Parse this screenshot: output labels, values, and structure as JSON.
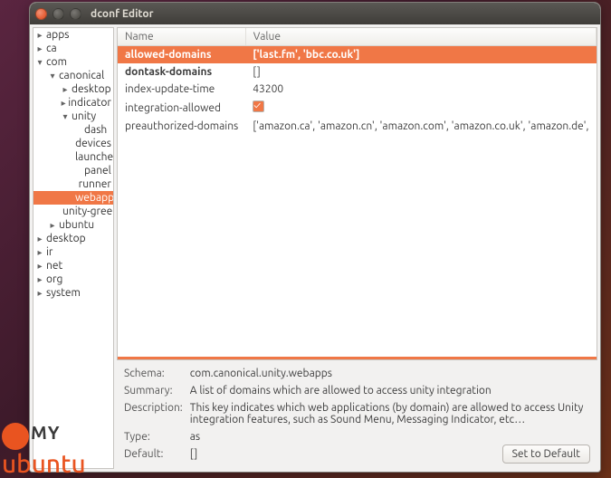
{
  "window": {
    "title": "dconf Editor"
  },
  "tree": [
    {
      "label": "apps",
      "depth": 0,
      "expanded": false,
      "hasChildren": true
    },
    {
      "label": "ca",
      "depth": 0,
      "expanded": false,
      "hasChildren": true
    },
    {
      "label": "com",
      "depth": 0,
      "expanded": true,
      "hasChildren": true
    },
    {
      "label": "canonical",
      "depth": 1,
      "expanded": true,
      "hasChildren": true
    },
    {
      "label": "desktop",
      "depth": 2,
      "expanded": false,
      "hasChildren": true
    },
    {
      "label": "indicator",
      "depth": 2,
      "expanded": false,
      "hasChildren": true
    },
    {
      "label": "unity",
      "depth": 2,
      "expanded": true,
      "hasChildren": true
    },
    {
      "label": "dash",
      "depth": 3,
      "expanded": false,
      "hasChildren": false
    },
    {
      "label": "devices",
      "depth": 3,
      "expanded": false,
      "hasChildren": false
    },
    {
      "label": "launcher",
      "depth": 3,
      "expanded": false,
      "hasChildren": false
    },
    {
      "label": "panel",
      "depth": 3,
      "expanded": false,
      "hasChildren": false
    },
    {
      "label": "runner",
      "depth": 3,
      "expanded": false,
      "hasChildren": false
    },
    {
      "label": "webapps",
      "depth": 3,
      "expanded": false,
      "hasChildren": false,
      "selected": true
    },
    {
      "label": "unity-greeter",
      "depth": 2,
      "expanded": false,
      "hasChildren": false
    },
    {
      "label": "ubuntu",
      "depth": 1,
      "expanded": false,
      "hasChildren": true
    },
    {
      "label": "desktop",
      "depth": 0,
      "expanded": false,
      "hasChildren": true
    },
    {
      "label": "ir",
      "depth": 0,
      "expanded": false,
      "hasChildren": true
    },
    {
      "label": "net",
      "depth": 0,
      "expanded": false,
      "hasChildren": true
    },
    {
      "label": "org",
      "depth": 0,
      "expanded": false,
      "hasChildren": true
    },
    {
      "label": "system",
      "depth": 0,
      "expanded": false,
      "hasChildren": true
    }
  ],
  "keys_header": {
    "name": "Name",
    "value": "Value"
  },
  "keys": [
    {
      "name": "allowed-domains",
      "value": "['last.fm', 'bbc.co.uk']",
      "selected": true,
      "bold": true
    },
    {
      "name": "dontask-domains",
      "value": "[]",
      "bold": true
    },
    {
      "name": "index-update-time",
      "value": "43200"
    },
    {
      "name": "integration-allowed",
      "value_checkbox": true
    },
    {
      "name": "preauthorized-domains",
      "value": "['amazon.ca', 'amazon.cn', 'amazon.com', 'amazon.co.uk', 'amazon.de',"
    }
  ],
  "details": {
    "schema_label": "Schema:",
    "schema": "com.canonical.unity.webapps",
    "summary_label": "Summary:",
    "summary": "A list of domains which are allowed to access unity integration",
    "description_label": "Description:",
    "description": "This key indicates which web applications (by domain) are allowed to access Unity integration features, such as Sound Menu, Messaging Indicator, etc…",
    "type_label": "Type:",
    "type": "as",
    "default_label": "Default:",
    "default": "[]",
    "set_default_btn": "Set to Default"
  },
  "watermark": {
    "line1": "MY",
    "line2": "ubuntu"
  }
}
